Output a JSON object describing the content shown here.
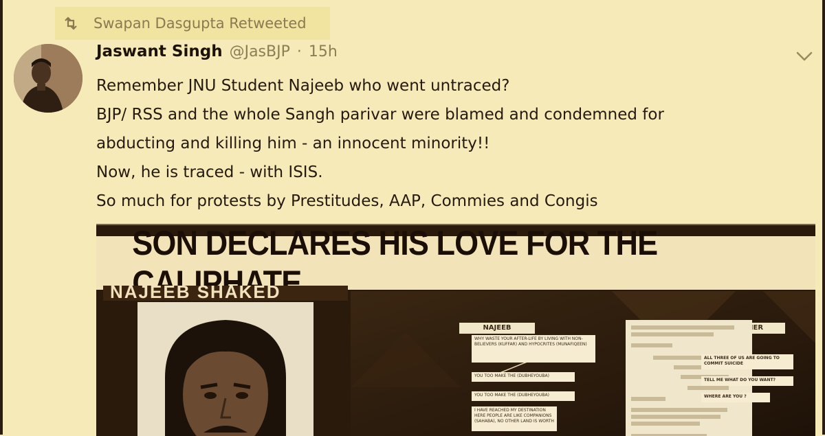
{
  "retweet": {
    "label": "Swapan Dasgupta Retweeted"
  },
  "tweet": {
    "display_name": "Jaswant Singh",
    "handle": "@JasBJP",
    "separator": "·",
    "time": "15h",
    "lines": [
      "Remember JNU Student Najeeb who went untraced?",
      "BJP/ RSS and the whole Sangh parivar were blamed and condemned for",
      "abducting and killing him - an innocent minority!!",
      "Now, he is traced - with ISIS.",
      "So much for protests by Prestitudes, AAP, Commies and Congis"
    ]
  },
  "media": {
    "headline": "SON DECLARES HIS LOVE FOR THE CALIPHATE",
    "name_strip": "NAJEEB SHAKED",
    "left_column": "NAJEEB",
    "right_column": "MOTHER",
    "najeeb_messages": [
      "WHY WASTE YOUR AFTER-LIFE BY LIVING WITH NON-BELIEVERS (KUFFAR) AND HYPOCRITES (MUNAFIQEEN)",
      "YOU TOO MAKE THE (DUBHEYOUBA)",
      "YOU TOO MAKE THE (DUBHEYOUBA)",
      "I HAVE REACHED MY DESTINATION HERE PEOPLE ARE LIKE COMPANIONS (SAHABA), NO OTHER LAND IS WORTH"
    ],
    "mother_messages": [
      "ALL THREE OF US ARE GOING TO COMMIT SUICIDE",
      "TELL ME WHAT DO YOU WANT?",
      "WHERE ARE YOU ?"
    ]
  },
  "icons": {
    "retweet": "retweet-icon",
    "caret": "chevron-down-icon"
  },
  "colors": {
    "background": "#f6eab8",
    "muted_text": "#8c7d55",
    "body_text": "#241a0e"
  }
}
